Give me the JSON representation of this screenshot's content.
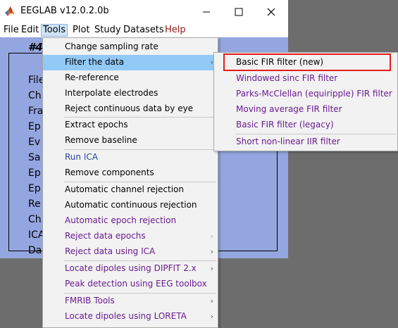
{
  "window": {
    "title": "EEGLAB v12.0.2.0b",
    "controls": [
      "minimize-icon",
      "maximize-icon",
      "close-icon"
    ]
  },
  "menubar": {
    "items": [
      "File",
      "Edit",
      "Tools",
      "Plot",
      "Study",
      "Datasets",
      "Help"
    ],
    "active": "Tools",
    "help_color": "#8b1a1a"
  },
  "panel": {
    "title": "#4",
    "labels": [
      "File",
      "Ch",
      "Fra",
      "Ep",
      "Ev",
      "Sa",
      "Ep",
      "Ep",
      "Re",
      "Ch",
      "ICA",
      "Da"
    ],
    "background": "#93a6e0"
  },
  "tools_menu": {
    "items": [
      {
        "label": "Change sampling rate",
        "color": "black"
      },
      {
        "label": "Filter the data",
        "color": "black",
        "submenu": true,
        "highlighted": true
      },
      {
        "label": "Re-reference",
        "color": "black"
      },
      {
        "label": "Interpolate electrodes",
        "color": "black"
      },
      {
        "label": "Reject continuous data by eye",
        "color": "black"
      },
      {
        "label": "Extract epochs",
        "color": "black"
      },
      {
        "label": "Remove baseline",
        "color": "black"
      },
      {
        "label": "Run ICA",
        "color": "blue"
      },
      {
        "label": "Remove components",
        "color": "black"
      },
      {
        "label": "Automatic channel rejection",
        "color": "black"
      },
      {
        "label": "Automatic continuous rejection",
        "color": "black"
      },
      {
        "label": "Automatic epoch rejection",
        "color": "purple"
      },
      {
        "label": "Reject data epochs",
        "color": "purple",
        "submenu": true
      },
      {
        "label": "Reject data using ICA",
        "color": "purple",
        "submenu": true
      },
      {
        "label": "Locate dipoles using DIPFIT 2.x",
        "color": "purple",
        "submenu": true
      },
      {
        "label": "Peak detection using EEG toolbox",
        "color": "purple"
      },
      {
        "label": "FMRIB Tools",
        "color": "purple",
        "submenu": true
      },
      {
        "label": "Locate dipoles using LORETA",
        "color": "purple",
        "submenu": true
      }
    ]
  },
  "filter_submenu": {
    "items": [
      {
        "label": "Basic FIR filter (new)",
        "color": "black",
        "annotated": true
      },
      {
        "label": "Windowed sinc FIR filter",
        "color": "purple"
      },
      {
        "label": "Parks-McClellan (equiripple) FIR filter",
        "color": "purple"
      },
      {
        "label": "Moving average FIR filter",
        "color": "purple"
      },
      {
        "label": "Basic FIR filter (legacy)",
        "color": "purple"
      },
      {
        "label": "Short non-linear IIR filter",
        "color": "purple"
      }
    ],
    "annotation_color": "#e51b1b"
  }
}
